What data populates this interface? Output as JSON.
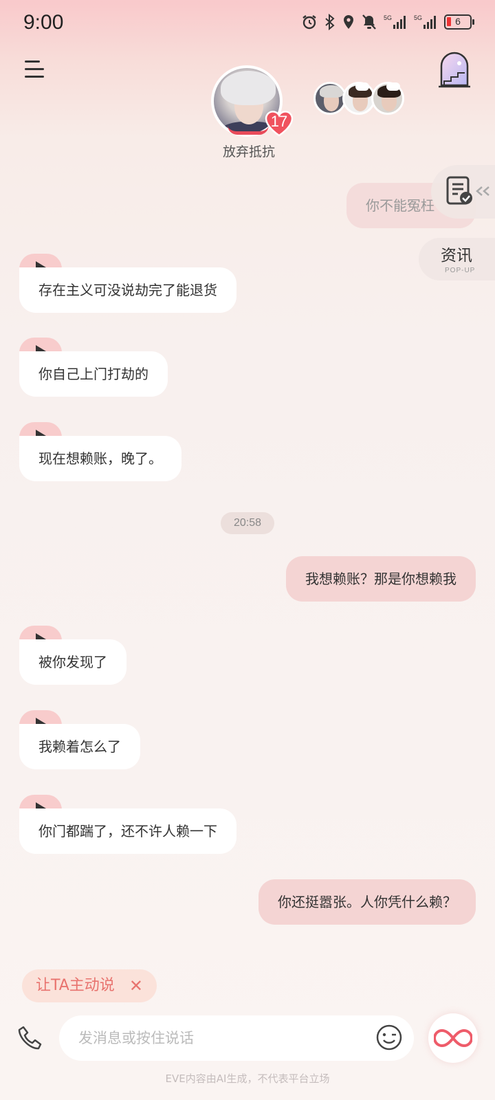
{
  "status_bar": {
    "time": "9:00",
    "battery": "6",
    "net1": "5G",
    "net2": "5G"
  },
  "header": {
    "character_name": "放弃抵抗",
    "affection_level": "17",
    "icons": [
      "menu-icon",
      "gate-icon",
      "heart-icon"
    ]
  },
  "side": {
    "news_label": "资讯",
    "news_sub": "POP-UP"
  },
  "messages": [
    {
      "role": "user",
      "text": "你不能冤枉"
    },
    {
      "role": "ai",
      "text": "存在主义可没说劫完了能退货"
    },
    {
      "role": "ai",
      "text": "你自己上门打劫的"
    },
    {
      "role": "ai",
      "text": "现在想赖账，晚了。"
    },
    {
      "role": "time",
      "text": "20:58"
    },
    {
      "role": "user",
      "text": "我想赖账？那是你想赖我"
    },
    {
      "role": "ai",
      "text": "被你发现了"
    },
    {
      "role": "ai",
      "text": "我赖着怎么了"
    },
    {
      "role": "ai",
      "text": "你门都踹了，还不许人赖一下"
    },
    {
      "role": "user",
      "text": "你还挺嚣张。人你凭什么赖？"
    }
  ],
  "chip": {
    "label": "让TA主动说",
    "close": "✕"
  },
  "input": {
    "placeholder": "发消息或按住说话"
  },
  "footer": "EVE内容由AI生成，不代表平台立场",
  "colors": {
    "accent": "#e84b5a",
    "user_bubble": "#f4d4d3",
    "play_tab": "#f8cccc"
  }
}
